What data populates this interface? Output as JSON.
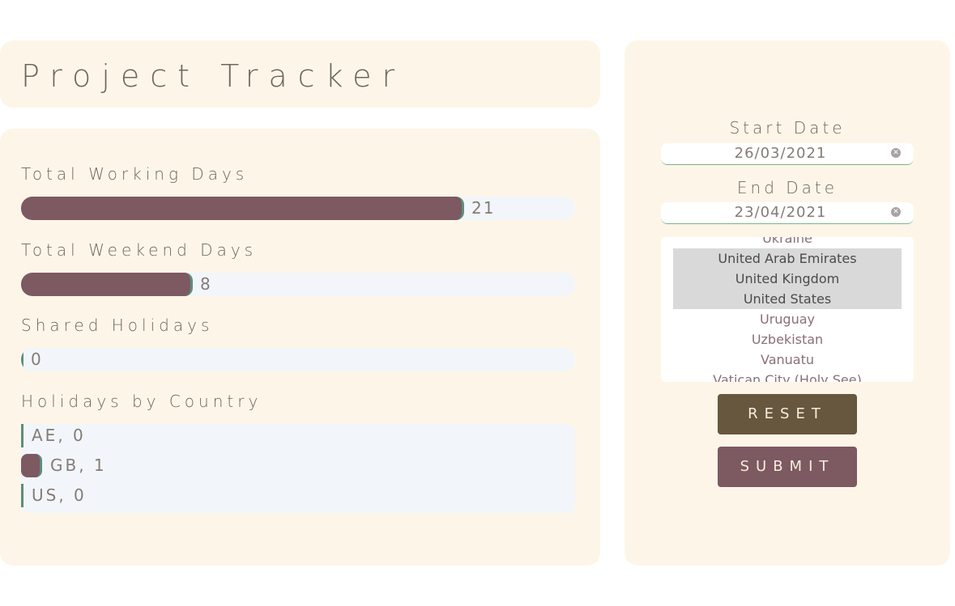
{
  "header": {
    "title": "Project Tracker"
  },
  "stats": {
    "working_days": {
      "label": "Total Working Days",
      "value": "21",
      "fraction": 0.8
    },
    "weekend_days": {
      "label": "Total Weekend Days",
      "value": "8",
      "fraction": 0.31
    },
    "shared_holidays": {
      "label": "Shared Holidays",
      "value": "0",
      "fraction": 0
    },
    "holidays_by_country": {
      "label": "Holidays by Country",
      "rows": [
        {
          "text": "AE, 0",
          "count": 0
        },
        {
          "text": "GB, 1",
          "count": 1
        },
        {
          "text": "US, 0",
          "count": 0
        }
      ]
    }
  },
  "form": {
    "start_date": {
      "label": "Start Date",
      "value": "26/03/2021"
    },
    "end_date": {
      "label": "End Date",
      "value": "23/04/2021"
    },
    "clear_icon": "clear-circle-icon",
    "countries": [
      {
        "name": "Ukraine",
        "selected": false
      },
      {
        "name": "United Arab Emirates",
        "selected": true
      },
      {
        "name": "United Kingdom",
        "selected": true
      },
      {
        "name": "United States",
        "selected": true
      },
      {
        "name": "Uruguay",
        "selected": false
      },
      {
        "name": "Uzbekistan",
        "selected": false
      },
      {
        "name": "Vanuatu",
        "selected": false
      },
      {
        "name": "Vatican City (Holy See)",
        "selected": false
      }
    ],
    "reset_label": "RESET",
    "submit_label": "SUBMIT"
  },
  "colors": {
    "panel": "#fdf6e8",
    "bar_fill": "#7d5962",
    "bar_edge": "#5b8f7b",
    "track": "#f2f6fa",
    "reset": "#67573f",
    "submit": "#7d5962"
  }
}
